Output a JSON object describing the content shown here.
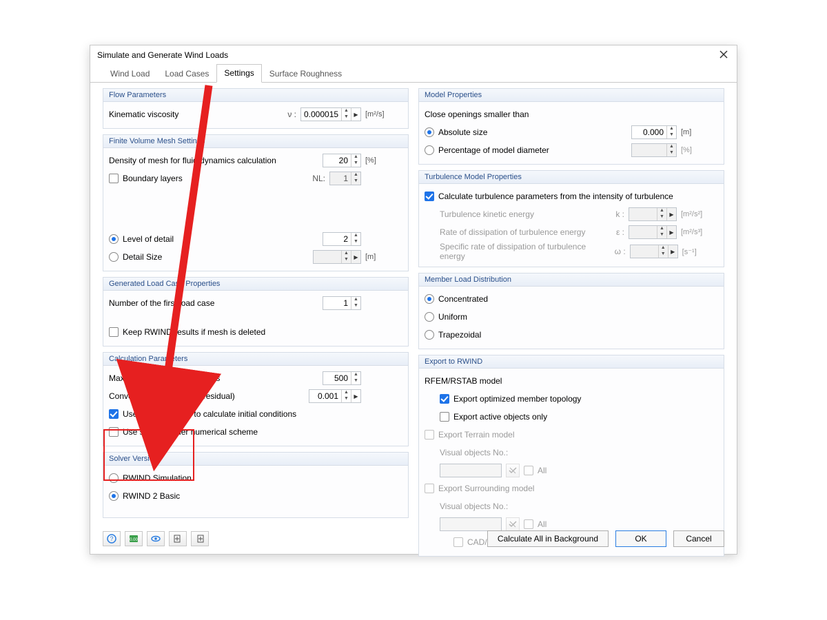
{
  "dialog": {
    "title": "Simulate and Generate Wind Loads"
  },
  "tabs": [
    {
      "label": "Wind Load"
    },
    {
      "label": "Load Cases"
    },
    {
      "label": "Settings"
    },
    {
      "label": "Surface Roughness"
    }
  ],
  "active_tab_index": 2,
  "flow_params": {
    "title": "Flow Parameters",
    "kinematic_viscosity": {
      "label": "Kinematic viscosity",
      "symbol": "ν :",
      "value": "0.000015",
      "unit": "[m²/s]"
    }
  },
  "fvm": {
    "title": "Finite Volume Mesh Settings",
    "density": {
      "label": "Density of mesh for fluid dynamics calculation",
      "value": "20",
      "unit": "[%]"
    },
    "boundary_layers": {
      "label": "Boundary layers",
      "checked": false,
      "nl_label": "NL:",
      "nl_value": "1"
    },
    "level_of_detail": {
      "label": "Level of detail",
      "value": "2"
    },
    "detail_size": {
      "label": "Detail Size",
      "value": "",
      "unit": "[m]"
    },
    "detail_mode_selected": "level"
  },
  "gen_lc": {
    "title": "Generated Load Case Properties",
    "first_lc": {
      "label": "Number of the first load case",
      "value": "1"
    },
    "keep_results": {
      "label": "Keep RWIND results if mesh is deleted",
      "checked": false
    }
  },
  "calc": {
    "title": "Calculation Parameters",
    "max_iter": {
      "label": "Maximum number of iterations",
      "value": "500"
    },
    "conv": {
      "label": "Convergence criterion (P-residual)",
      "value": "0.001"
    },
    "potential_flow": {
      "label": "Use Potential Flow to calculate initial conditions",
      "checked": true
    },
    "second_order": {
      "label": "Use second-order numerical scheme",
      "checked": false
    }
  },
  "solver": {
    "title": "Solver Version",
    "opt_sim": "RWIND Simulation",
    "opt_basic": "RWIND 2 Basic",
    "selected": "basic"
  },
  "model_props": {
    "title": "Model Properties",
    "close_openings": "Close openings smaller than",
    "abs": {
      "label": "Absolute size",
      "value": "0.000",
      "unit": "[m]"
    },
    "pct": {
      "label": "Percentage of model diameter",
      "value": "",
      "unit": "[%]"
    },
    "selected": "abs"
  },
  "turb": {
    "title": "Turbulence Model Properties",
    "calc_from_intensity": {
      "label": "Calculate turbulence parameters from the intensity of turbulence",
      "checked": true
    },
    "tke": {
      "label": "Turbulence kinetic energy",
      "symbol": "k :",
      "unit": "[m²/s²]"
    },
    "eps": {
      "label": "Rate of dissipation of turbulence energy",
      "symbol": "ε :",
      "unit": "[m²/s³]"
    },
    "omega": {
      "label": "Specific rate of dissipation of turbulence energy",
      "symbol": "ω :",
      "unit": "[s⁻¹]"
    }
  },
  "mld": {
    "title": "Member Load Distribution",
    "concentrated": "Concentrated",
    "uniform": "Uniform",
    "trapezoidal": "Trapezoidal",
    "selected": "concentrated"
  },
  "export": {
    "title": "Export to RWIND",
    "rfem": "RFEM/RSTAB model",
    "opt_topology": {
      "label": "Export optimized member topology",
      "checked": true
    },
    "active_only": {
      "label": "Export active objects only",
      "checked": false
    },
    "terrain": {
      "label": "Export Terrain model",
      "checked": false
    },
    "surrounding": {
      "label": "Export Surrounding model",
      "checked": false
    },
    "visual_no": "Visual objects No.:",
    "all": "All",
    "cadbim": {
      "label": "CAD/BIM models",
      "checked": false
    }
  },
  "footer": {
    "calc_bg": "Calculate All in Background",
    "ok": "OK",
    "cancel": "Cancel"
  }
}
